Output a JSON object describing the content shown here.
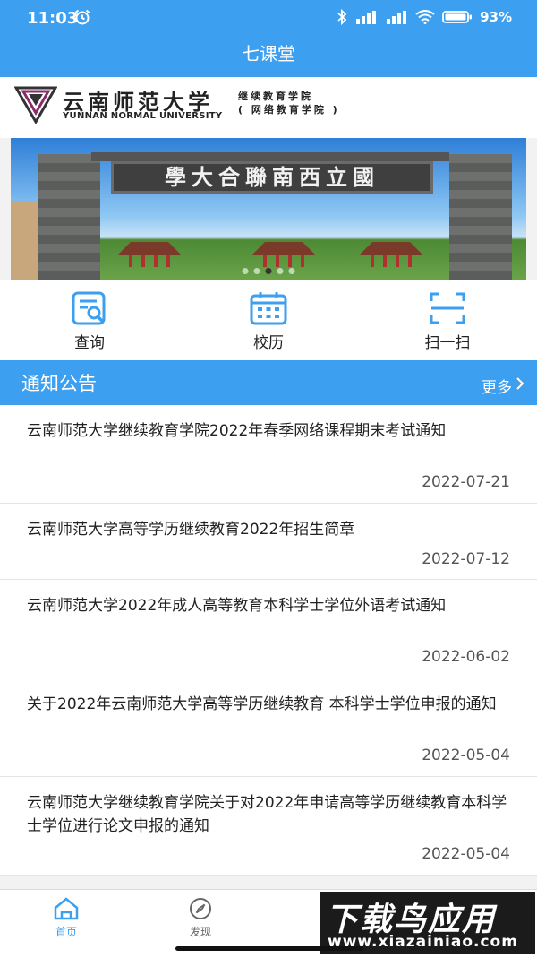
{
  "status": {
    "time": "11:03",
    "battery": "93%"
  },
  "header": {
    "title": "七课堂"
  },
  "logo": {
    "cn": "云南师范大学",
    "en": "YUNNAN NORMAL UNIVERSITY",
    "sub1": "继续教育学院",
    "sub2": "( 网络教育学院 )"
  },
  "banner": {
    "gate_text": "學大合聯南西立國",
    "slides": 5,
    "active_slide": 3
  },
  "quick_actions": [
    {
      "label": "查询",
      "icon": "search-doc-icon"
    },
    {
      "label": "校历",
      "icon": "calendar-icon"
    },
    {
      "label": "扫一扫",
      "icon": "scan-icon"
    }
  ],
  "notices": {
    "heading": "通知公告",
    "more": "更多",
    "items": [
      {
        "title": "云南师范大学继续教育学院2022年春季网络课程期末考试通知",
        "date": "2022-07-21"
      },
      {
        "title": "云南师范大学高等学历继续教育2022年招生简章",
        "date": "2022-07-12"
      },
      {
        "title": "云南师范大学2022年成人高等教育本科学士学位外语考试通知",
        "date": "2022-06-02"
      },
      {
        "title": "关于2022年云南师范大学高等学历继续教育 本科学士学位申报的通知",
        "date": "2022-05-04"
      },
      {
        "title": "云南师范大学继续教育学院关于对2022年申请高等学历继续教育本科学士学位进行论文申报的通知",
        "date": "2022-05-04"
      }
    ]
  },
  "tabs": [
    {
      "label": "首页",
      "icon": "home-icon",
      "active": true
    },
    {
      "label": "发现",
      "icon": "compass-icon",
      "active": false
    }
  ],
  "watermark": {
    "line1": "下载鸟应用",
    "line2": "www.xiazainiao.com"
  },
  "colors": {
    "primary": "#3d9ff0"
  }
}
